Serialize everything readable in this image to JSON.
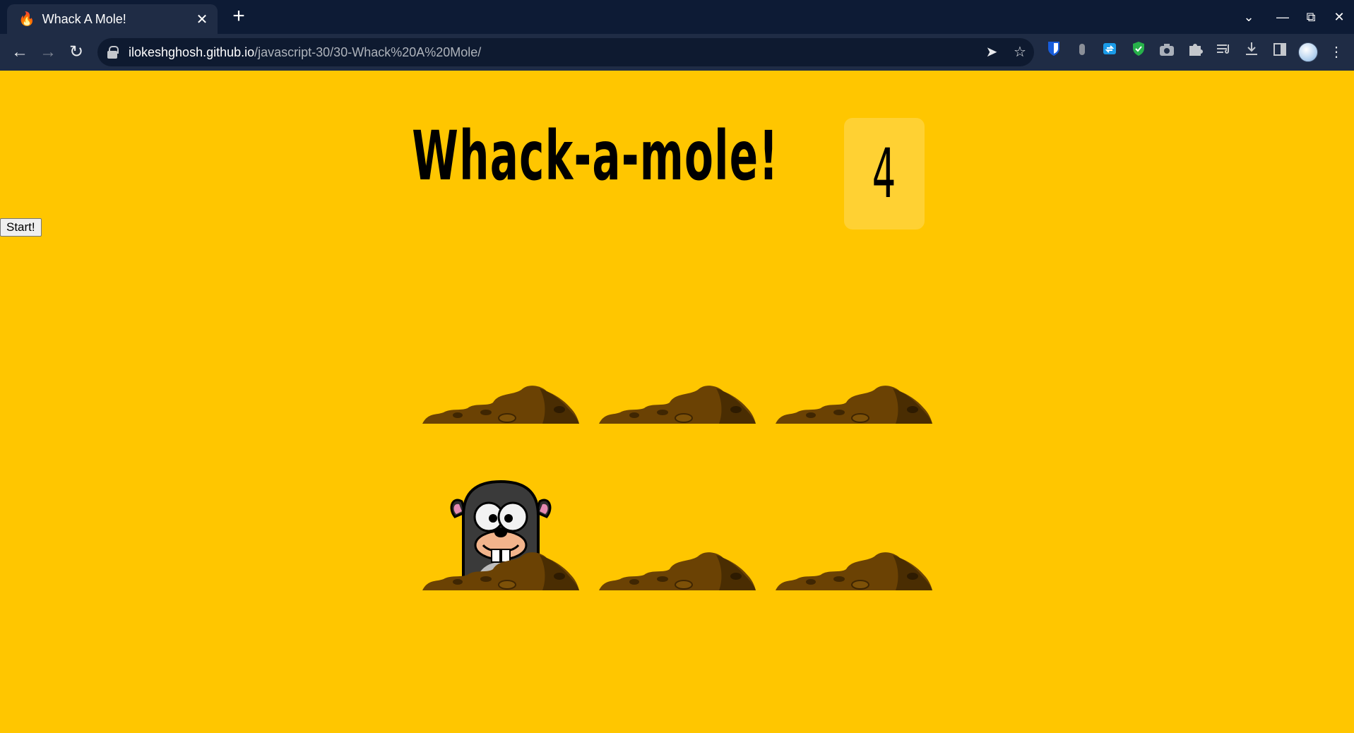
{
  "browser": {
    "tab": {
      "title": "Whack A Mole!",
      "favicon": "fire-icon",
      "close_icon": "close-icon"
    },
    "new_tab_icon": "plus-icon",
    "window_controls": [
      "chevron-down-icon",
      "minimize-icon",
      "restore-icon",
      "close-icon"
    ],
    "nav": [
      "back-icon",
      "forward-icon",
      "reload-icon"
    ],
    "url_host": "ilokeshghosh.github.io",
    "url_path": "/javascript-30/30-Whack%20A%20Mole/",
    "omnibox_icons": [
      "share-icon",
      "star-icon"
    ],
    "extensions": [
      "bitwarden-icon",
      "extension-gray-icon",
      "translate-icon",
      "shield-icon",
      "camera-icon",
      "puzzle-icon",
      "reading-list-icon",
      "download-icon",
      "side-panel-icon",
      "profile-avatar",
      "more-icon"
    ]
  },
  "page": {
    "start_button": "Start!",
    "title": "Whack-a-mole!",
    "score": "4",
    "colors": {
      "background": "#ffc600",
      "dirt": "#6b4204"
    }
  },
  "game": {
    "holes": [
      {
        "mole_visible": false
      },
      {
        "mole_visible": false
      },
      {
        "mole_visible": false
      },
      {
        "mole_visible": true
      },
      {
        "mole_visible": false
      },
      {
        "mole_visible": false
      }
    ]
  }
}
